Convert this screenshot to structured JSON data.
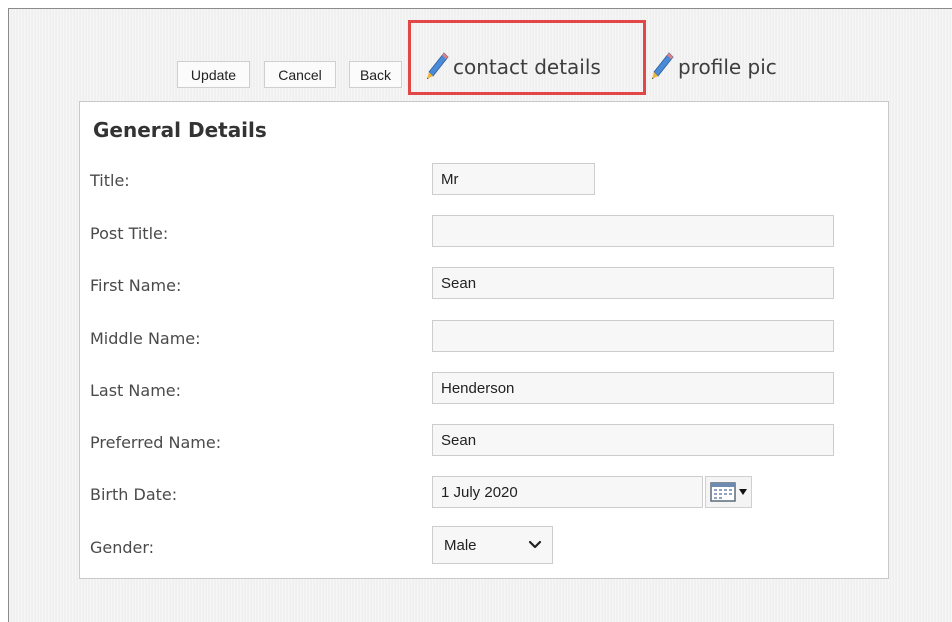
{
  "toolbar": {
    "update_label": "Update",
    "cancel_label": "Cancel",
    "back_label": "Back",
    "contact_details_label": "contact details",
    "profile_pic_label": "profile pic"
  },
  "form": {
    "section_title": "General Details",
    "fields": [
      {
        "label": "Title:",
        "value": "Mr"
      },
      {
        "label": "Post Title:",
        "value": ""
      },
      {
        "label": "First Name:",
        "value": "Sean"
      },
      {
        "label": "Middle Name:",
        "value": ""
      },
      {
        "label": "Last Name:",
        "value": "Henderson"
      },
      {
        "label": "Preferred Name:",
        "value": "Sean"
      },
      {
        "label": "Birth Date:",
        "value": "1 July 2020"
      },
      {
        "label": "Gender:",
        "value": "Male"
      }
    ]
  },
  "icons": {
    "pencil": "pencil-icon",
    "calendar": "calendar-icon",
    "dropdown": "chevron-down-icon"
  },
  "colors": {
    "highlight": "#e24747",
    "pencil_body": "#4a8ad8",
    "pencil_tip": "#f2b63c"
  }
}
